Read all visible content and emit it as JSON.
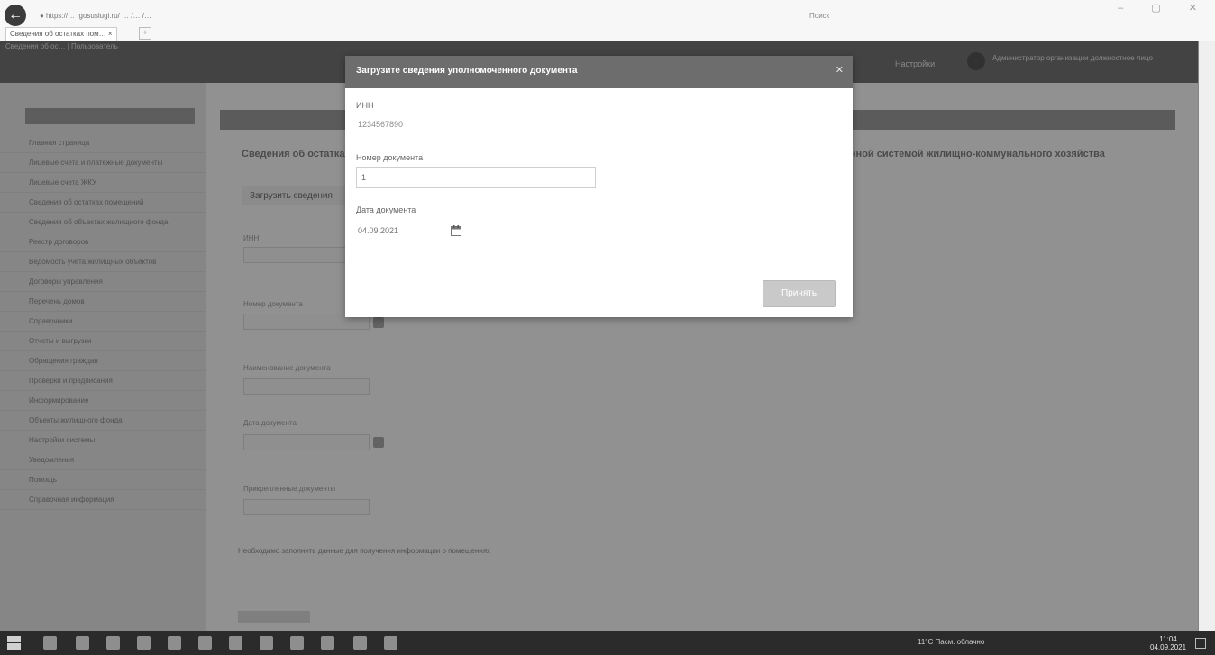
{
  "browser": {
    "address": "● https://… .gosuslugi.ru/ … /… /…",
    "search_placeholder": "Поиск",
    "tab_title": "Сведения об остатках пом… ×",
    "tab_new": "+"
  },
  "site": {
    "breadcrumb": "Сведения об ос… | Пользователь",
    "menu_label": "Настройки",
    "user_name": "Администратор организации должностное лицо"
  },
  "sidebar": {
    "items": [
      "Главная страница",
      "Лицевые счета и платежные документы",
      "Лицевые счета ЖКУ",
      "Сведения об остатках помещений",
      "Сведения об объектах жилищного фонда",
      "Реестр договоров",
      "Ведомость учета жилищных объектов",
      "Договоры управления",
      "Перечень домов",
      "Справочники",
      "Отчеты и выгрузки",
      "Обращения граждан",
      "Проверки и предписания",
      "Информирование",
      "Объекты жилищного фонда",
      "Настройки системы",
      "Уведомления",
      "Помощь",
      "Справочная информация"
    ]
  },
  "main": {
    "title": "Сведения об остатках помещений с предоставлением информационного взаимодействия с государственной информационной системой жилищно-коммунального хозяйства",
    "load_button": "Загрузить сведения",
    "labels": {
      "inn": "ИНН",
      "doc_number": "Номер документа",
      "doc_name": "Наименование документа",
      "doc_date": "Дата документа",
      "attachments": "Прикрепленные документы"
    },
    "link_text": "Необходимо заполнить данные для получения информации о помещениях"
  },
  "modal": {
    "title": "Загрузите сведения уполномоченного документа",
    "close": "✕",
    "inn_label": "ИНН",
    "inn_value": "1234567890",
    "doc_number_label": "Номер документа",
    "doc_number_value": "1",
    "doc_date_label": "Дата документа",
    "doc_date_value": "04.09.2021",
    "submit": "Принять"
  },
  "taskbar": {
    "tray_text": "11°C Пасм. облачно",
    "time": "11:04",
    "date": "04.09.2021"
  }
}
